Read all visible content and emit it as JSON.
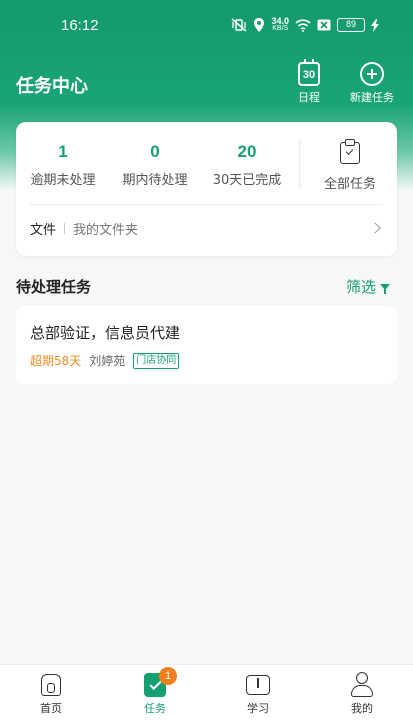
{
  "status_bar": {
    "time": "16:12",
    "net_speed": "34.0",
    "net_unit": "KB/S",
    "battery": "89"
  },
  "header": {
    "title": "任务中心",
    "schedule_label": "日程",
    "calendar_day": "30",
    "new_task_label": "新建任务"
  },
  "stats": [
    {
      "value": "1",
      "label": "逾期未处理"
    },
    {
      "value": "0",
      "label": "期内待处理"
    },
    {
      "value": "20",
      "label": "30天已完成"
    }
  ],
  "all_tasks_label": "全部任务",
  "files": {
    "label": "文件",
    "folder": "我的文件夹"
  },
  "pending_section": {
    "title": "待处理任务",
    "filter_label": "筛选"
  },
  "tasks": [
    {
      "title": "总部验证，信息员代建",
      "overdue": "超期58天",
      "owner": "刘婷苑",
      "tag": "门店协同"
    }
  ],
  "bottom_nav": {
    "home": "首页",
    "tasks": "任务",
    "tasks_badge": "1",
    "study": "学习",
    "mine": "我的"
  },
  "colors": {
    "accent": "#169f70",
    "overdue": "#f08a24",
    "badge": "#f07f1e"
  }
}
